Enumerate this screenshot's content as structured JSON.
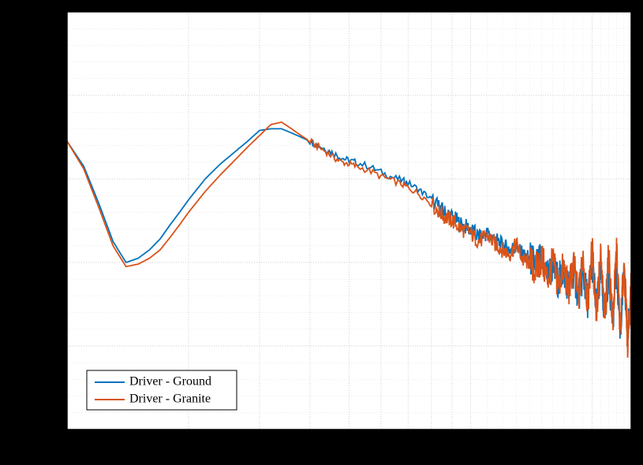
{
  "chart_data": {
    "type": "line",
    "title": "",
    "xlabel": "",
    "ylabel": "",
    "xscale": "log",
    "xlim": [
      1,
      25
    ],
    "ylim": [
      -4,
      1
    ],
    "grid": true,
    "legend_position": "lower-left",
    "legend": [
      "Driver - Ground",
      "Driver - Granite"
    ],
    "x_common": [
      1.0,
      1.1,
      1.2,
      1.3,
      1.4,
      1.5,
      1.6,
      1.7,
      1.8,
      1.9,
      2.0,
      2.2,
      2.4,
      2.6,
      2.8,
      3.0,
      3.2,
      3.4,
      3.6,
      3.8,
      4.0,
      4.2,
      4.4,
      4.6,
      4.8,
      5.0,
      5.2,
      5.6,
      6.0,
      6.4,
      6.8,
      7.0,
      7.4,
      7.8,
      8.2,
      8.6,
      9.0,
      9.5,
      10.0,
      10.5,
      11.0,
      11.5,
      12.0,
      12.5,
      13.0,
      13.5,
      14.0,
      14.5,
      15.0,
      15.5,
      16.0,
      16.5,
      17.0,
      17.5,
      18.0,
      18.5,
      19.0,
      19.5,
      20.0,
      20.5,
      21.0,
      21.5,
      22.0,
      22.5,
      23.0,
      23.5,
      24.0,
      24.5,
      25.0
    ],
    "series": [
      {
        "name": "Driver - Ground",
        "color": "#0072bd",
        "values": [
          -0.55,
          -0.85,
          -1.3,
          -1.75,
          -2.0,
          -1.95,
          -1.85,
          -1.72,
          -1.55,
          -1.4,
          -1.25,
          -1.0,
          -0.82,
          -0.68,
          -0.55,
          -0.42,
          -0.4,
          -0.4,
          -0.45,
          -0.5,
          -0.55,
          -0.6,
          -0.65,
          -0.7,
          -0.75,
          -0.78,
          -0.8,
          -0.85,
          -0.92,
          -0.98,
          -1.02,
          -1.05,
          -1.12,
          -1.2,
          -1.3,
          -1.4,
          -1.45,
          -1.55,
          -1.6,
          -1.7,
          -1.65,
          -1.72,
          -1.8,
          -1.85,
          -1.8,
          -1.92,
          -1.95,
          -2.02,
          -1.98,
          -2.15,
          -2.05,
          -2.22,
          -2.1,
          -2.3,
          -2.1,
          -2.4,
          -2.15,
          -2.45,
          -2.0,
          -2.55,
          -2.15,
          -2.6,
          -2.1,
          -2.7,
          -2.05,
          -2.8,
          -2.15,
          -2.9,
          -2.35
        ]
      },
      {
        "name": "Driver - Granite",
        "color": "#d95319",
        "values": [
          -0.55,
          -0.88,
          -1.35,
          -1.8,
          -2.05,
          -2.02,
          -1.95,
          -1.85,
          -1.7,
          -1.55,
          -1.4,
          -1.15,
          -0.95,
          -0.78,
          -0.62,
          -0.48,
          -0.35,
          -0.32,
          -0.4,
          -0.48,
          -0.55,
          -0.62,
          -0.68,
          -0.75,
          -0.8,
          -0.82,
          -0.85,
          -0.9,
          -0.97,
          -1.02,
          -1.07,
          -1.1,
          -1.17,
          -1.25,
          -1.35,
          -1.45,
          -1.5,
          -1.6,
          -1.65,
          -1.75,
          -1.68,
          -1.78,
          -1.85,
          -1.9,
          -1.78,
          -1.98,
          -2.0,
          -2.1,
          -1.95,
          -2.2,
          -2.0,
          -2.28,
          -2.05,
          -2.35,
          -2.0,
          -2.45,
          -1.9,
          -2.5,
          -1.85,
          -2.6,
          -1.95,
          -2.68,
          -1.9,
          -2.75,
          -1.85,
          -2.85,
          -2.0,
          -2.95,
          -2.3
        ]
      }
    ]
  }
}
